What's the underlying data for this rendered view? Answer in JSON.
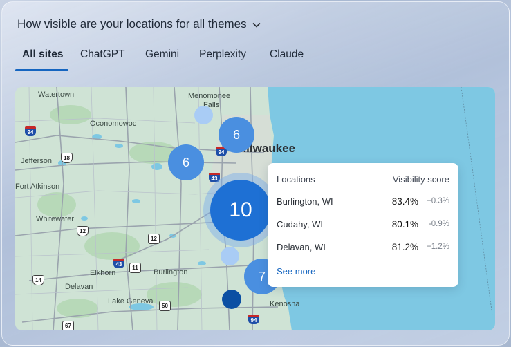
{
  "header": {
    "title": "How visible are your locations for all themes",
    "chevron_icon": "chevron-down-icon"
  },
  "tabs": [
    {
      "label": "All sites",
      "active": true
    },
    {
      "label": "ChatGPT",
      "active": false
    },
    {
      "label": "Gemini",
      "active": false
    },
    {
      "label": "Perplexity",
      "active": false
    },
    {
      "label": "Claude",
      "active": false
    }
  ],
  "map": {
    "places": {
      "watertown": "Watertown",
      "menomonee": "Menomonee",
      "falls": "Falls",
      "oconomowoc": "Oconomowoc",
      "milwaukee": "Milwaukee",
      "jefferson": "Jefferson",
      "fort_atkinson": "Fort Atkinson",
      "whitewater": "Whitewater",
      "elkhorn": "Elkhorn",
      "burlington": "Burlington",
      "delavan": "Delavan",
      "lake_geneva": "Lake Geneva",
      "kenosha": "Kenosha"
    },
    "shields": {
      "i94_a": "94",
      "i94_b": "94",
      "i94_c": "94",
      "i43_a": "43",
      "i43_b": "43",
      "us18": "18",
      "us12": "12",
      "us14": "14",
      "r11": "11",
      "r12": "12",
      "r50": "50",
      "r67": "67"
    },
    "clusters": {
      "c1": "6",
      "c2": "6",
      "c3": "10",
      "c4": "7"
    },
    "colors": {
      "land": "#cfe3d5",
      "water": "#7ec8e3",
      "cluster": "#4a8fe0",
      "cluster_big": "#1e70d4"
    }
  },
  "popup": {
    "col_locations": "Locations",
    "col_score": "Visibility score",
    "rows": [
      {
        "location": "Burlington, WI",
        "score": "83.4%",
        "delta": "+0.3%"
      },
      {
        "location": "Cudahy, WI",
        "score": "80.1%",
        "delta": "-0.9%"
      },
      {
        "location": "Delavan, WI",
        "score": "81.2%",
        "delta": "+1.2%"
      }
    ],
    "see_more": "See more"
  }
}
